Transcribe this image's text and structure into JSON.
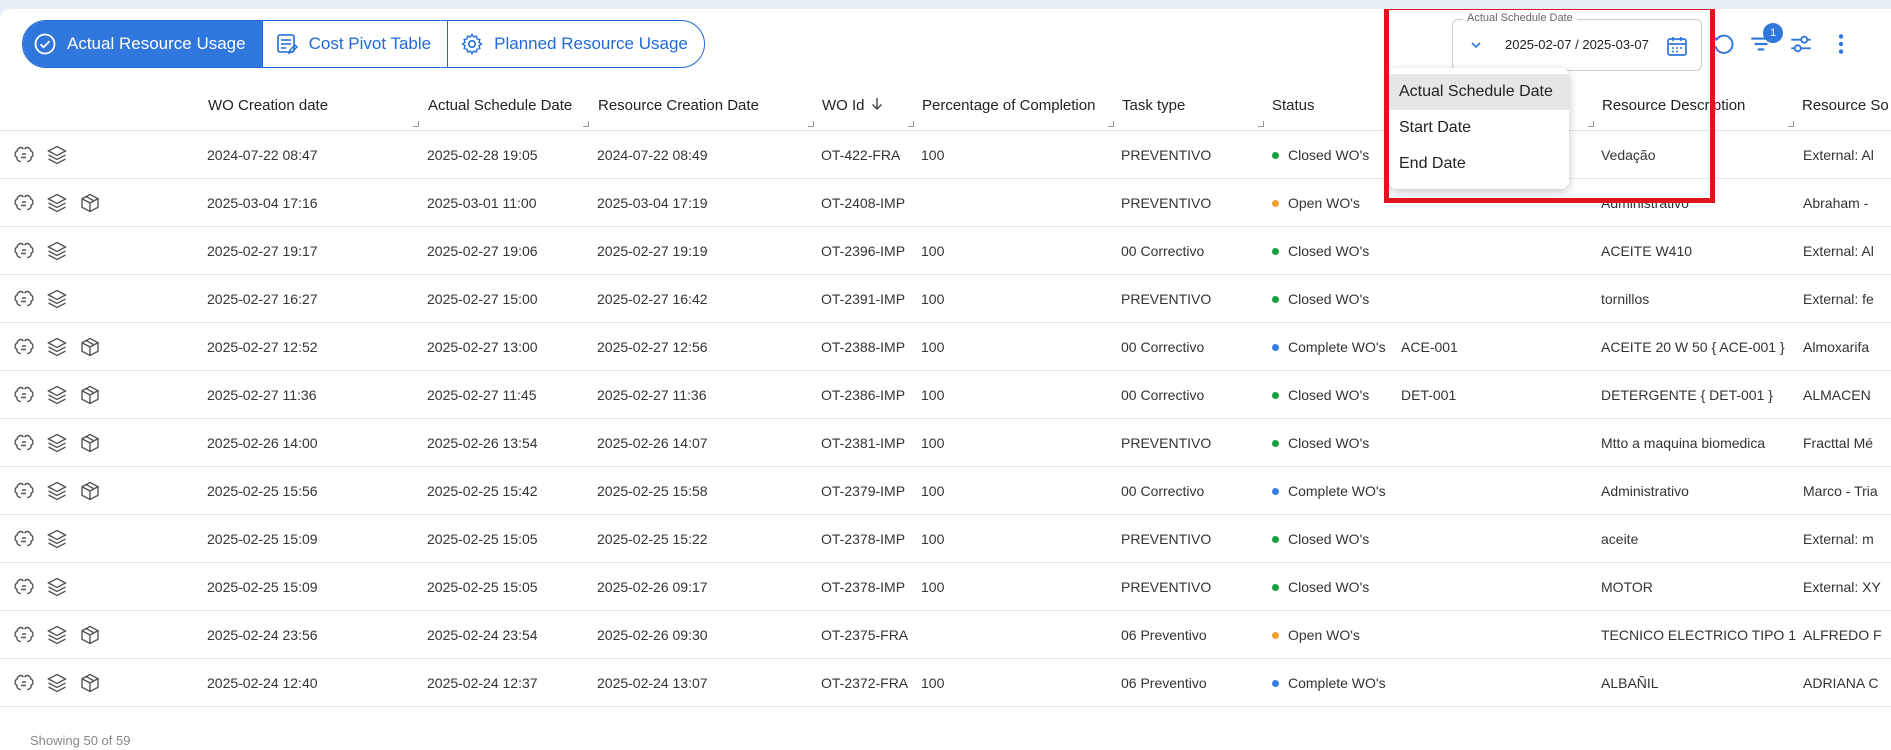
{
  "tabs": [
    {
      "label": "Actual Resource Usage",
      "icon": "check-circle-icon",
      "active": true
    },
    {
      "label": "Cost Pivot Table",
      "icon": "table-edit-icon",
      "active": false
    },
    {
      "label": "Planned Resource Usage",
      "icon": "gear-icon",
      "active": false
    }
  ],
  "date_filter": {
    "label": "Actual Schedule Date",
    "value": "2025-02-07 / 2025-03-07"
  },
  "filter_badge": "1",
  "date_menu": {
    "items": [
      "Actual Schedule Date",
      "Start Date",
      "End Date"
    ],
    "selected": "Actual Schedule Date"
  },
  "columns": [
    "WO Creation date",
    "Actual Schedule Date",
    "Resource Creation Date",
    "WO Id",
    "Percentage of Completion",
    "Task type",
    "Status",
    "",
    "Resource Description",
    "Resource So"
  ],
  "status_colors": {
    "Closed WO's": "#1a9e3f",
    "Open WO's": "#f0a030",
    "Complete WO's": "#3b7ee0"
  },
  "rows": [
    {
      "icons": 2,
      "wo_created": "2024-07-22 08:47",
      "actual_schedule": "2025-02-28 19:05",
      "resource_created": "2024-07-22 08:49",
      "wo_id": "OT-422-FRA",
      "pct": "100",
      "task": "PREVENTIVO",
      "status": "Closed WO's",
      "code": "",
      "desc": "Vedação",
      "source": "External: Al"
    },
    {
      "icons": 3,
      "wo_created": "2025-03-04 17:16",
      "actual_schedule": "2025-03-01 11:00",
      "resource_created": "2025-03-04 17:19",
      "wo_id": "OT-2408-IMP",
      "pct": "",
      "task": "PREVENTIVO",
      "status": "Open WO's",
      "code": "",
      "desc": "Administrativo",
      "source": "Abraham -"
    },
    {
      "icons": 2,
      "wo_created": "2025-02-27 19:17",
      "actual_schedule": "2025-02-27 19:06",
      "resource_created": "2025-02-27 19:19",
      "wo_id": "OT-2396-IMP",
      "pct": "100",
      "task": "00 Correctivo",
      "status": "Closed WO's",
      "code": "",
      "desc": "ACEITE W410",
      "source": "External: Al"
    },
    {
      "icons": 2,
      "wo_created": "2025-02-27 16:27",
      "actual_schedule": "2025-02-27 15:00",
      "resource_created": "2025-02-27 16:42",
      "wo_id": "OT-2391-IMP",
      "pct": "100",
      "task": "PREVENTIVO",
      "status": "Closed WO's",
      "code": "",
      "desc": "tornillos",
      "source": "External: fe"
    },
    {
      "icons": 3,
      "wo_created": "2025-02-27 12:52",
      "actual_schedule": "2025-02-27 13:00",
      "resource_created": "2025-02-27 12:56",
      "wo_id": "OT-2388-IMP",
      "pct": "100",
      "task": "00 Correctivo",
      "status": "Complete WO's",
      "code": "ACE-001",
      "desc": "ACEITE 20 W 50 { ACE-001 }",
      "source": "Almoxarifa"
    },
    {
      "icons": 3,
      "wo_created": "2025-02-27 11:36",
      "actual_schedule": "2025-02-27 11:45",
      "resource_created": "2025-02-27 11:36",
      "wo_id": "OT-2386-IMP",
      "pct": "100",
      "task": "00 Correctivo",
      "status": "Closed WO's",
      "code": "DET-001",
      "desc": "DETERGENTE { DET-001 }",
      "source": "ALMACEN"
    },
    {
      "icons": 3,
      "wo_created": "2025-02-26 14:00",
      "actual_schedule": "2025-02-26 13:54",
      "resource_created": "2025-02-26 14:07",
      "wo_id": "OT-2381-IMP",
      "pct": "100",
      "task": "PREVENTIVO",
      "status": "Closed WO's",
      "code": "",
      "desc": "Mtto a maquina biomedica",
      "source": "Fracttal Mé"
    },
    {
      "icons": 3,
      "wo_created": "2025-02-25 15:56",
      "actual_schedule": "2025-02-25 15:42",
      "resource_created": "2025-02-25 15:58",
      "wo_id": "OT-2379-IMP",
      "pct": "100",
      "task": "00 Correctivo",
      "status": "Complete WO's",
      "code": "",
      "desc": "Administrativo",
      "source": "Marco - Tria"
    },
    {
      "icons": 2,
      "wo_created": "2025-02-25 15:09",
      "actual_schedule": "2025-02-25 15:05",
      "resource_created": "2025-02-25 15:22",
      "wo_id": "OT-2378-IMP",
      "pct": "100",
      "task": "PREVENTIVO",
      "status": "Closed WO's",
      "code": "",
      "desc": "aceite",
      "source": "External: m"
    },
    {
      "icons": 2,
      "wo_created": "2025-02-25 15:09",
      "actual_schedule": "2025-02-25 15:05",
      "resource_created": "2025-02-26 09:17",
      "wo_id": "OT-2378-IMP",
      "pct": "100",
      "task": "PREVENTIVO",
      "status": "Closed WO's",
      "code": "",
      "desc": "MOTOR",
      "source": "External: XY"
    },
    {
      "icons": 3,
      "wo_created": "2025-02-24 23:56",
      "actual_schedule": "2025-02-24 23:54",
      "resource_created": "2025-02-26 09:30",
      "wo_id": "OT-2375-FRA",
      "pct": "",
      "task": "06 Preventivo",
      "status": "Open WO's",
      "code": "",
      "desc": "TECNICO ELECTRICO TIPO 1",
      "source": "ALFREDO F"
    },
    {
      "icons": 3,
      "wo_created": "2025-02-24 12:40",
      "actual_schedule": "2025-02-24 12:37",
      "resource_created": "2025-02-24 13:07",
      "wo_id": "OT-2372-FRA",
      "pct": "100",
      "task": "06 Preventivo",
      "status": "Complete WO's",
      "code": "",
      "desc": "ALBAÑIL",
      "source": "ADRIANA C"
    }
  ],
  "footer": "Showing 50 of 59"
}
